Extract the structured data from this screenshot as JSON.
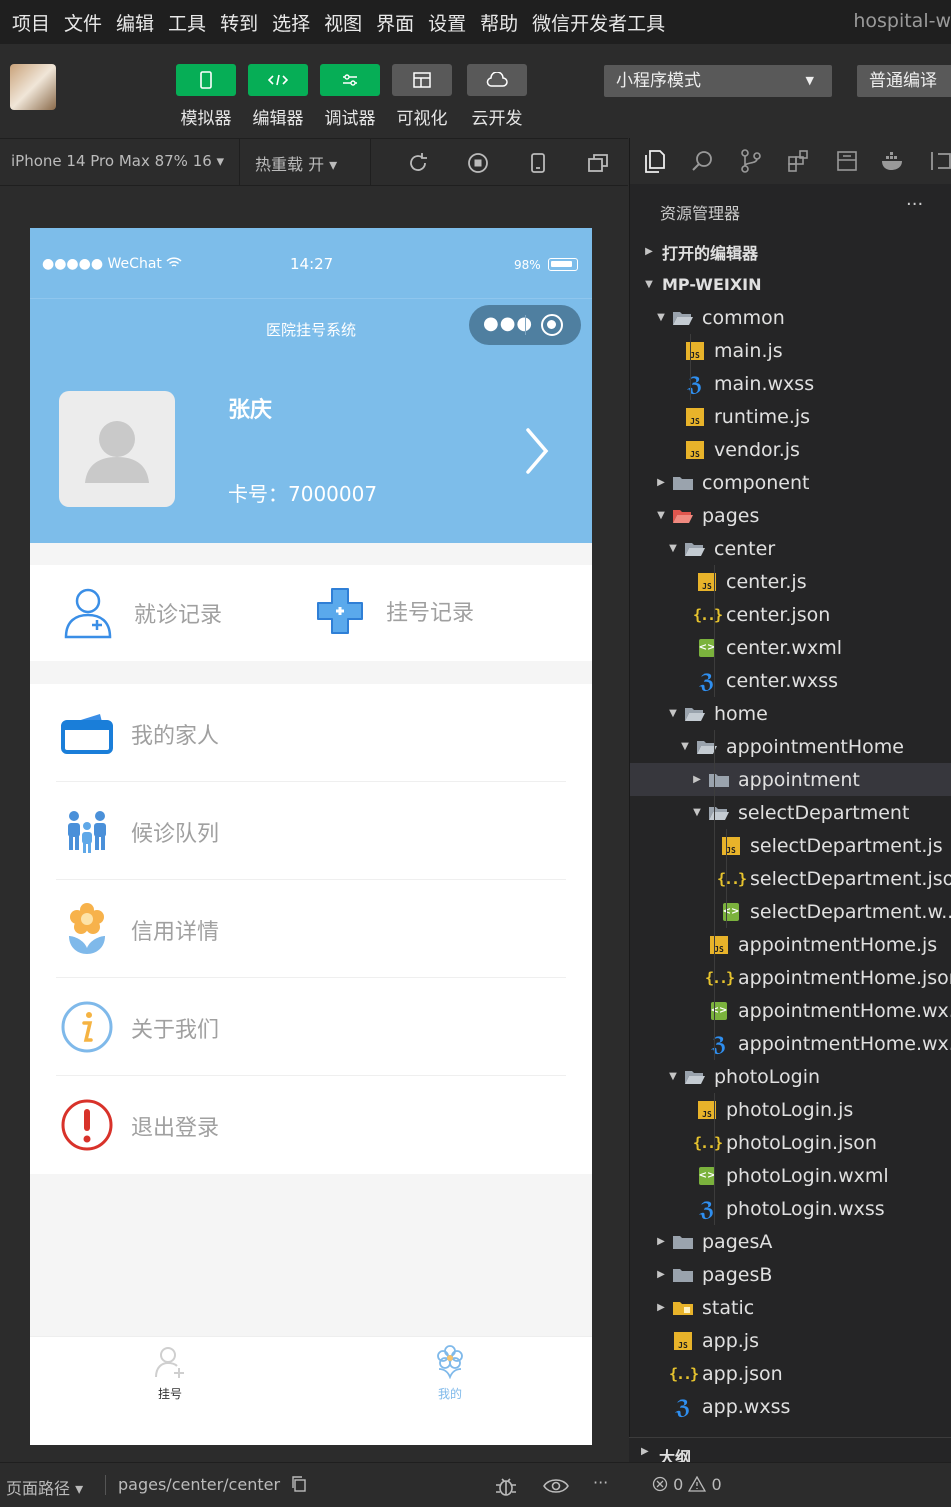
{
  "menubar": {
    "items": [
      "项目",
      "文件",
      "编辑",
      "工具",
      "转到",
      "选择",
      "视图",
      "界面",
      "设置",
      "帮助",
      "微信开发者工具"
    ],
    "title": "hospital-w"
  },
  "toolbar": {
    "tools": [
      {
        "label": "模拟器",
        "icon": "phone-icon",
        "active": true
      },
      {
        "label": "编辑器",
        "icon": "code-icon",
        "active": true
      },
      {
        "label": "调试器",
        "icon": "debug-icon",
        "active": true
      },
      {
        "label": "可视化",
        "icon": "layout-icon",
        "active": false
      },
      {
        "label": "云开发",
        "icon": "cloud-icon",
        "active": false
      }
    ],
    "mode": "小程序模式",
    "compile": "普通编译"
  },
  "simbar": {
    "device": "iPhone 14 Pro Max 87% 16 ▾",
    "hotreload": "热重载 开 ▾"
  },
  "phone": {
    "carrier": "●●●●● WeChat",
    "time": "14:27",
    "battery": "98%",
    "nav_title": "医院挂号系统",
    "profile": {
      "name": "张庆",
      "card": "卡号：7000007"
    },
    "quick": [
      {
        "label": "就诊记录"
      },
      {
        "label": "挂号记录"
      }
    ],
    "menu": [
      {
        "label": "我的家人"
      },
      {
        "label": "候诊队列"
      },
      {
        "label": "信用详情"
      },
      {
        "label": "关于我们"
      },
      {
        "label": "退出登录"
      }
    ],
    "tabs": [
      {
        "label": "挂号",
        "active": false
      },
      {
        "label": "我的",
        "active": true
      }
    ]
  },
  "bottombar": {
    "path_label": "页面路径 ▾",
    "path": "pages/center/center"
  },
  "explorer": {
    "title": "资源管理器",
    "more": "···",
    "tree": [
      {
        "name": "打开的编辑器",
        "depth": 0,
        "twist": "closed",
        "type": "section"
      },
      {
        "name": "MP-WEIXIN",
        "depth": 0,
        "twist": "open",
        "type": "section"
      },
      {
        "name": "common",
        "depth": 1,
        "twist": "open",
        "type": "folder-open"
      },
      {
        "name": "main.js",
        "depth": 2,
        "twist": "",
        "type": "js"
      },
      {
        "name": "main.wxss",
        "depth": 2,
        "twist": "",
        "type": "css"
      },
      {
        "name": "runtime.js",
        "depth": 2,
        "twist": "",
        "type": "js"
      },
      {
        "name": "vendor.js",
        "depth": 2,
        "twist": "",
        "type": "js"
      },
      {
        "name": "component",
        "depth": 1,
        "twist": "closed",
        "type": "folder"
      },
      {
        "name": "pages",
        "depth": 1,
        "twist": "open",
        "type": "folder-pages"
      },
      {
        "name": "center",
        "depth": 2,
        "twist": "open",
        "type": "folder-open"
      },
      {
        "name": "center.js",
        "depth": 3,
        "twist": "",
        "type": "js"
      },
      {
        "name": "center.json",
        "depth": 3,
        "twist": "",
        "type": "json"
      },
      {
        "name": "center.wxml",
        "depth": 3,
        "twist": "",
        "type": "wxml"
      },
      {
        "name": "center.wxss",
        "depth": 3,
        "twist": "",
        "type": "css"
      },
      {
        "name": "home",
        "depth": 2,
        "twist": "open",
        "type": "folder-open"
      },
      {
        "name": "appointmentHome",
        "depth": 3,
        "twist": "open",
        "type": "folder-open"
      },
      {
        "name": "appointment",
        "depth": 4,
        "twist": "closed",
        "type": "folder",
        "selected": true
      },
      {
        "name": "selectDepartment",
        "depth": 4,
        "twist": "open",
        "type": "folder-open"
      },
      {
        "name": "selectDepartment.js",
        "depth": 5,
        "twist": "",
        "type": "js"
      },
      {
        "name": "selectDepartment.json",
        "depth": 5,
        "twist": "",
        "type": "json"
      },
      {
        "name": "selectDepartment.w...",
        "depth": 5,
        "twist": "",
        "type": "wxml"
      },
      {
        "name": "appointmentHome.js",
        "depth": 4,
        "twist": "",
        "type": "js"
      },
      {
        "name": "appointmentHome.json",
        "depth": 4,
        "twist": "",
        "type": "json"
      },
      {
        "name": "appointmentHome.wx...",
        "depth": 4,
        "twist": "",
        "type": "wxml"
      },
      {
        "name": "appointmentHome.wx...",
        "depth": 4,
        "twist": "",
        "type": "css"
      },
      {
        "name": "photoLogin",
        "depth": 2,
        "twist": "open",
        "type": "folder-open"
      },
      {
        "name": "photoLogin.js",
        "depth": 3,
        "twist": "",
        "type": "js"
      },
      {
        "name": "photoLogin.json",
        "depth": 3,
        "twist": "",
        "type": "json"
      },
      {
        "name": "photoLogin.wxml",
        "depth": 3,
        "twist": "",
        "type": "wxml"
      },
      {
        "name": "photoLogin.wxss",
        "depth": 3,
        "twist": "",
        "type": "css"
      },
      {
        "name": "pagesA",
        "depth": 1,
        "twist": "closed",
        "type": "folder"
      },
      {
        "name": "pagesB",
        "depth": 1,
        "twist": "closed",
        "type": "folder"
      },
      {
        "name": "static",
        "depth": 1,
        "twist": "closed",
        "type": "folder-static"
      },
      {
        "name": "app.js",
        "depth": 1,
        "twist": "",
        "type": "js"
      },
      {
        "name": "app.json",
        "depth": 1,
        "twist": "",
        "type": "json"
      },
      {
        "name": "app.wxss",
        "depth": 1,
        "twist": "",
        "type": "css"
      }
    ],
    "outline": "大纲",
    "problems": "0",
    "warnings": "0"
  },
  "colors": {
    "accent_green": "#06ae56",
    "phone_blue": "#7dbdea",
    "selection": "#37373d"
  }
}
